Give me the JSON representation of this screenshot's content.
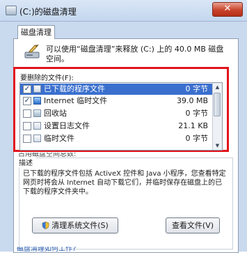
{
  "window": {
    "title": "(C:)的磁盘清理",
    "close_label": "✕"
  },
  "tabs": [
    {
      "label": "磁盘清理"
    }
  ],
  "summary": {
    "text": "可以使用“磁盘清理”来释放 (C:) 上的 40.0 MB 磁盘空间。",
    "icon": "disk-cleanup-icon"
  },
  "file_list": {
    "label": "要删除的文件(F):",
    "items": [
      {
        "name": "已下载的程序文件",
        "size": "0 字节",
        "checked": true,
        "selected": true,
        "icon": "folder-icon"
      },
      {
        "name": "Internet 临时文件",
        "size": "39.0 MB",
        "checked": true,
        "selected": false,
        "icon": "internet-explorer-icon"
      },
      {
        "name": "回收站",
        "size": "0 字节",
        "checked": false,
        "selected": false,
        "icon": "recycle-bin-icon"
      },
      {
        "name": "设置日志文件",
        "size": "21.1 KB",
        "checked": false,
        "selected": false,
        "icon": "file-icon"
      },
      {
        "name": "临时文件",
        "size": "0 字节",
        "checked": false,
        "selected": false,
        "icon": "file-icon"
      }
    ]
  },
  "total_line": "占用磁盘空间总数:",
  "description": {
    "caption": "描述",
    "text": "已下载的程序文件包括 ActiveX 控件和 Java 小程序，您查看特定网页时将会从 Internet 自动下载它们，并临时保存在磁盘上的已下载的程序文件夹中。"
  },
  "buttons": {
    "clean_system": "清理系统文件(S)",
    "view_files": "查看文件(V)"
  },
  "footer_link": "磁盘清理如何工作?",
  "colors": {
    "selection": "#3a6fce",
    "highlight_frame": "#e2141b"
  }
}
